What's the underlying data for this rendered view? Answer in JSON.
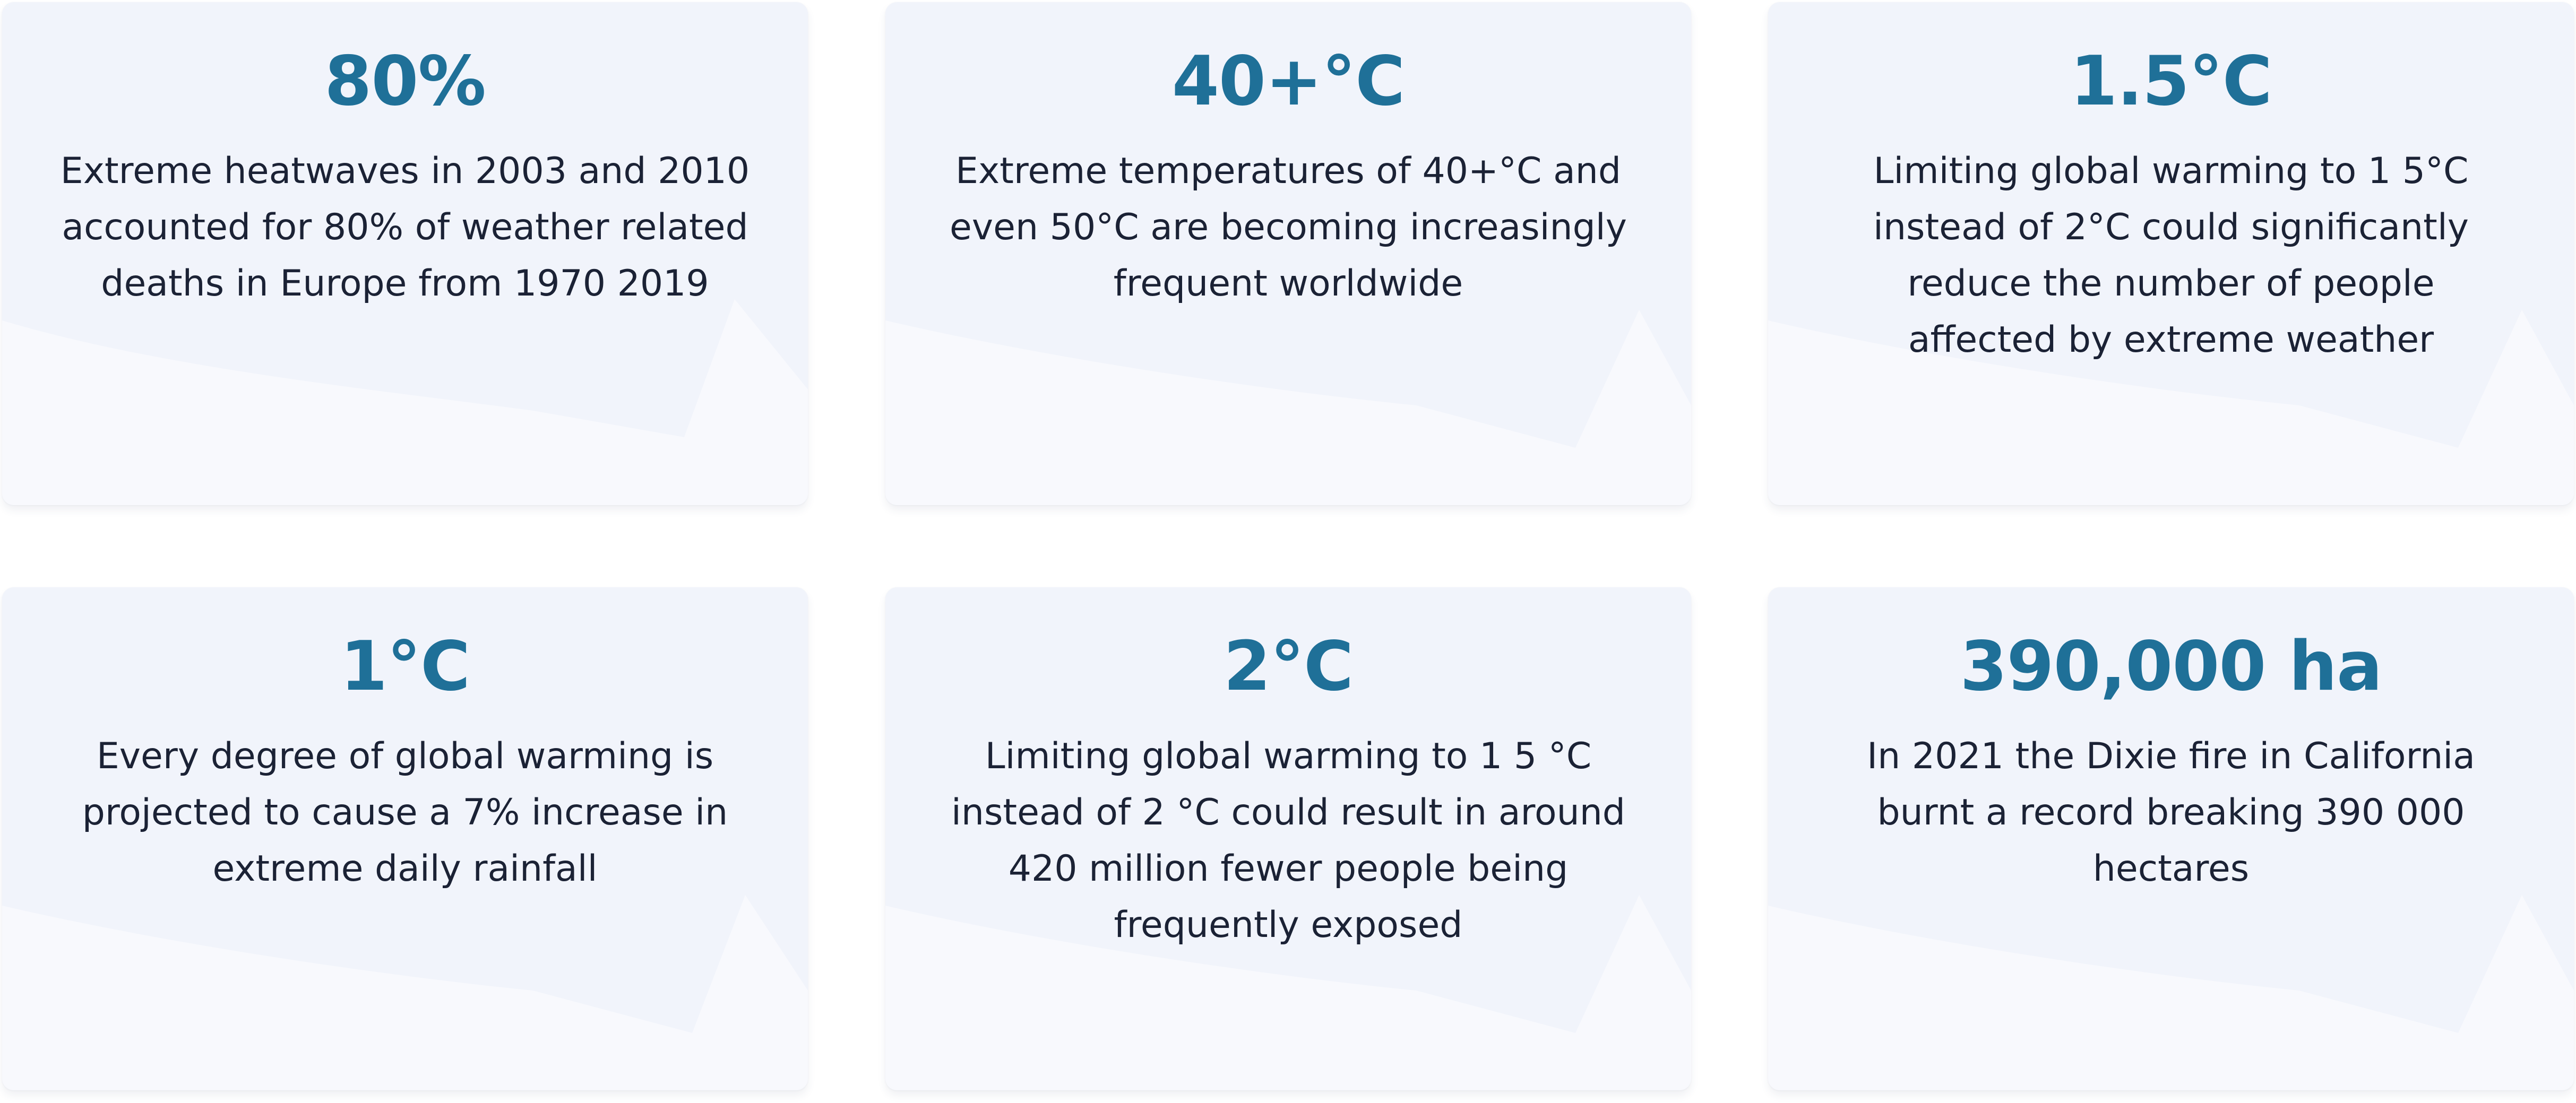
{
  "cards": [
    {
      "stat": "80%",
      "lines": [
        "Extreme heatwaves in 2003 and 2010",
        "accounted for 80% of weather related",
        "deaths in Europe from 1970 2019"
      ]
    },
    {
      "stat": "40+°C",
      "lines": [
        "Extreme temperatures of 40+°C and",
        "even 50°C are becoming increasingly",
        "frequent worldwide"
      ]
    },
    {
      "stat": "1.5°C",
      "lines": [
        "Limiting global warming to 1 5°C",
        "instead of 2°C could significantly",
        "reduce the number of people",
        "affected by extreme weather"
      ]
    },
    {
      "stat": "1°C",
      "lines": [
        "Every degree of global warming is",
        "projected to cause a 7% increase in",
        "extreme daily rainfall"
      ]
    },
    {
      "stat": "2°C",
      "lines": [
        "Limiting global warming to 1 5 °C",
        "instead of 2 °C could result in around",
        "420 million fewer people being",
        "frequently exposed"
      ]
    },
    {
      "stat": "390,000 ha",
      "lines": [
        "In 2021 the Dixie fire in California",
        "burnt a record breaking 390 000",
        "hectares"
      ]
    }
  ],
  "colors": {
    "stat": "#1f7098",
    "text": "#1b2235",
    "card": "#f1f4fb"
  }
}
